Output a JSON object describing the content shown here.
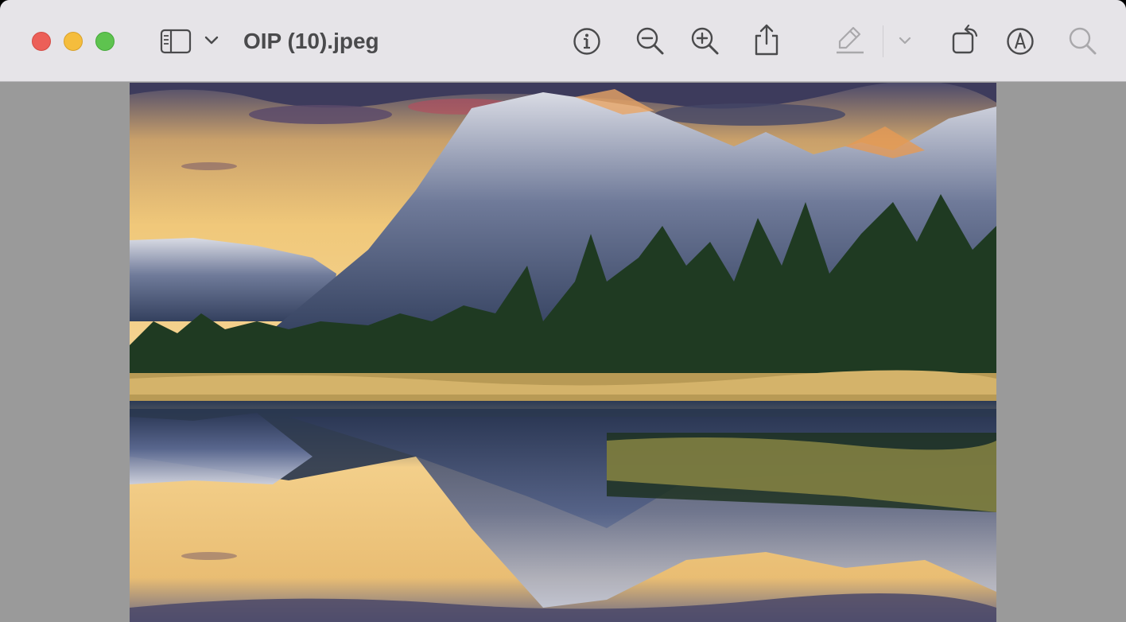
{
  "window": {
    "title": "OIP (10).jpeg",
    "buttons": {
      "close": "close-window",
      "minimize": "minimize-window",
      "maximize": "fullscreen-window"
    }
  },
  "toolbar": {
    "icons": [
      "sidebar-icon",
      "chevron-down-icon",
      "info-icon",
      "zoom-out-icon",
      "zoom-in-icon",
      "share-icon",
      "highlight-pen-icon",
      "chevron-down-icon",
      "rotate-icon",
      "markup-icon",
      "search-icon"
    ]
  },
  "colors": {
    "toolbar_bg": "#e6e4e8",
    "viewer_bg": "#9a9a9a",
    "icon": "#4a4a4c",
    "icon_disabled": "#a9a8ab",
    "close": "#ec5f58",
    "minimize": "#f5bd3d",
    "maximize": "#5ec34f"
  },
  "document": {
    "image_subject": "mountain-lake-reflection-photo"
  }
}
